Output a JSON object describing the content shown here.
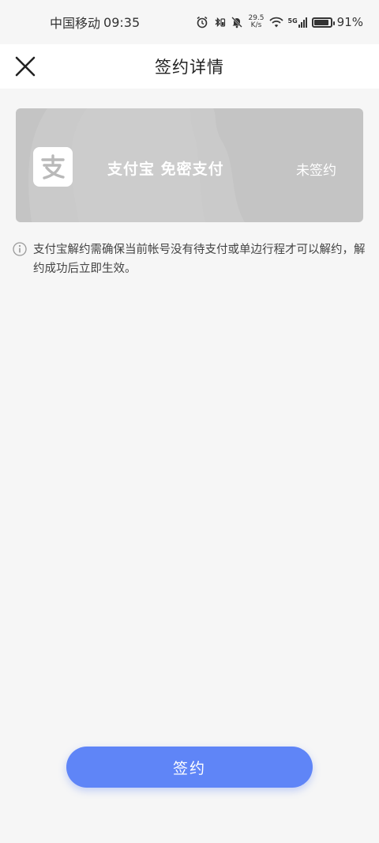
{
  "status_bar": {
    "carrier": "中国移动",
    "time": "09:35",
    "net_speed_value": "29.5",
    "net_speed_unit": "K/s",
    "signal_label": "5G",
    "battery": "91%",
    "battery_level": 0.91
  },
  "header": {
    "title": "签约详情",
    "close_icon": "close-icon"
  },
  "card": {
    "logo_icon": "alipay-logo-icon",
    "title": "支付宝 免密支付",
    "status": "未签约",
    "background_color": "#c4c4c4"
  },
  "notice": {
    "icon": "info-icon",
    "text": "支付宝解约需确保当前帐号没有待支付或单边行程才可以解约，解约成功后立即生效。"
  },
  "actions": {
    "sign_label": "签约",
    "accent_color": "#5f85f7"
  }
}
